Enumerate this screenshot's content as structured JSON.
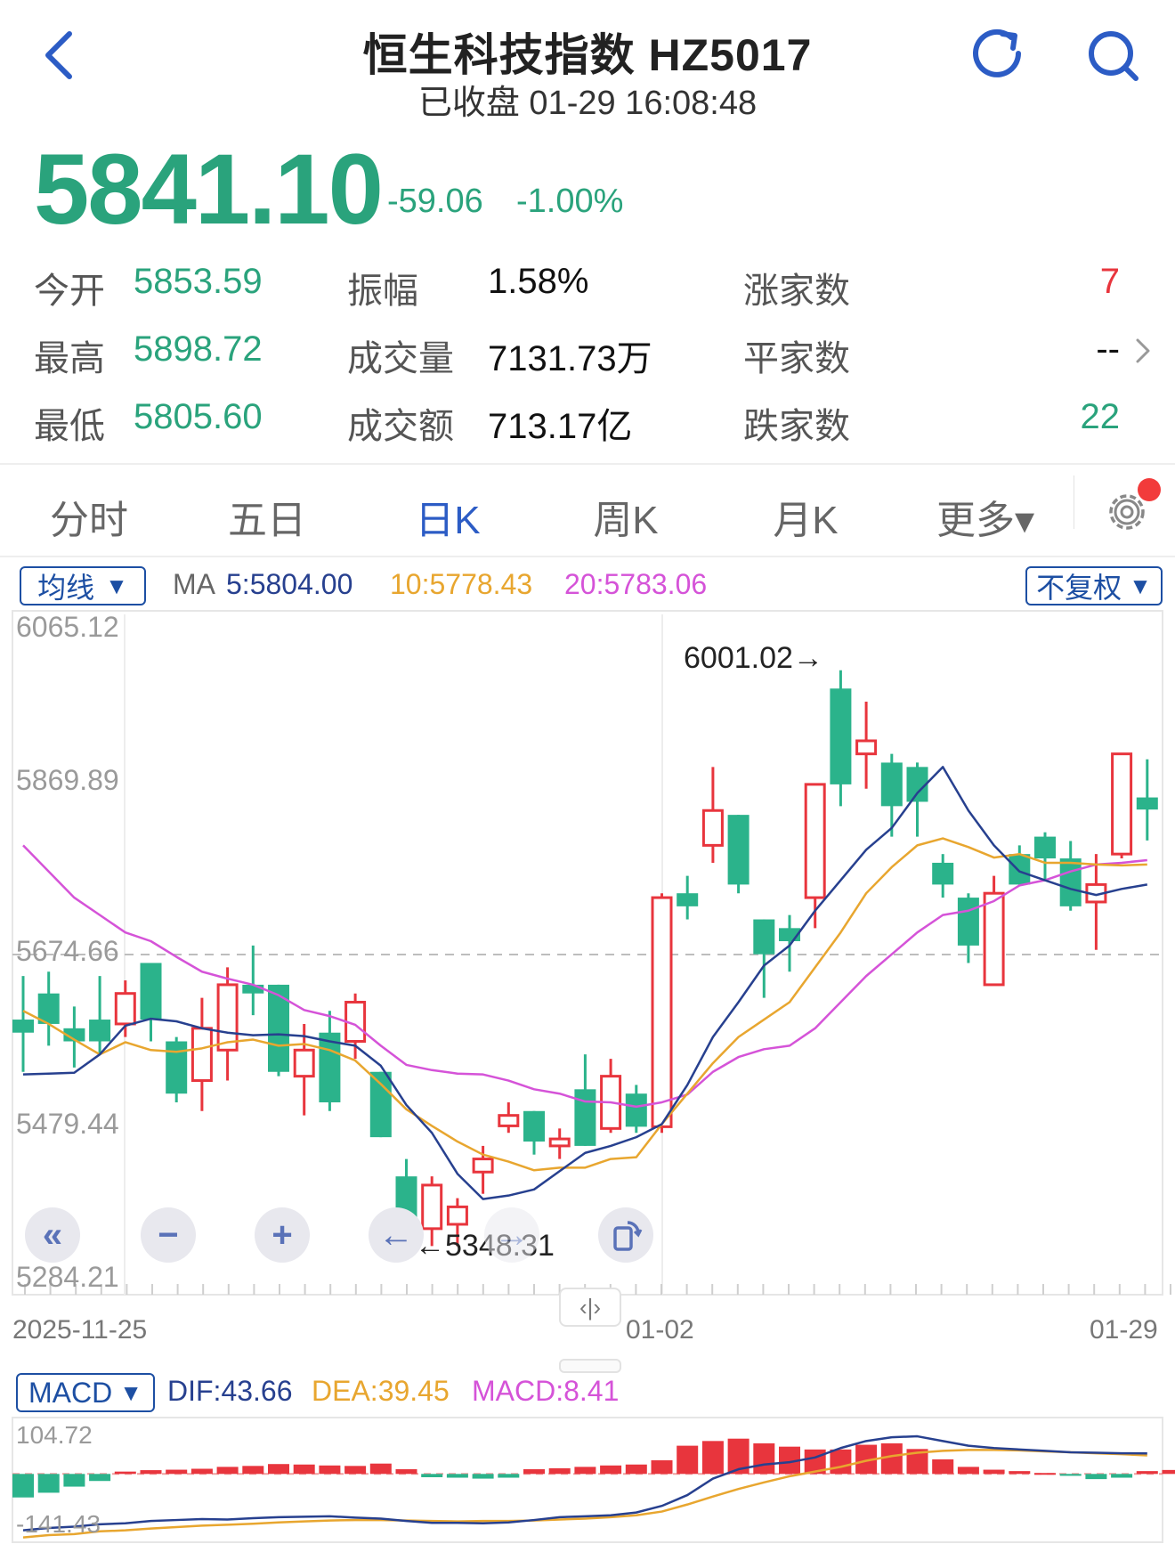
{
  "header": {
    "title": "恒生科技指数 HZ5017",
    "subtitle": "已收盘 01-29 16:08:48"
  },
  "quote": {
    "price": "5841.10",
    "change": "-59.06",
    "change_pct": "-1.00%",
    "stats": [
      {
        "label": "今开",
        "value": "5853.59"
      },
      {
        "label": "最高",
        "value": "5898.72"
      },
      {
        "label": "最低",
        "value": "5805.60"
      },
      {
        "label": "振幅",
        "value": "1.58%"
      },
      {
        "label": "成交量",
        "value": "7131.73万"
      },
      {
        "label": "成交额",
        "value": "713.17亿"
      },
      {
        "label": "涨家数",
        "value": "7"
      },
      {
        "label": "平家数",
        "value": "--"
      },
      {
        "label": "跌家数",
        "value": "22"
      }
    ]
  },
  "tabs": [
    {
      "label": "分时"
    },
    {
      "label": "五日"
    },
    {
      "label": "日K"
    },
    {
      "label": "周K"
    },
    {
      "label": "月K"
    },
    {
      "label": "更多▾"
    }
  ],
  "active_tab": "日K",
  "legend": {
    "ma_selector": "均线",
    "ma_prefix": "MA",
    "ma5": "5:5804.00",
    "ma10": "10:5778.43",
    "ma20": "20:5783.06",
    "adjust_selector": "不复权",
    "macd_selector": "MACD",
    "dif": "DIF:43.66",
    "dea": "DEA:39.45",
    "macd": "MACD:8.41"
  },
  "colors": {
    "up": "#e8353d",
    "down": "#2bb38b",
    "ma5": "#27408f",
    "ma10": "#e8a62f",
    "ma20": "#d553d8",
    "accent": "#2c5cc5"
  },
  "chart": {
    "y_ticks": [
      "6065.12",
      "5869.89",
      "5674.66",
      "5479.44",
      "5284.21"
    ],
    "high_marker": "6001.02→",
    "low_marker": "←5348.31",
    "dates": [
      "2025-11-25",
      "01-02",
      "01-29"
    ],
    "macd_ticks": [
      "104.72",
      "-141.43"
    ]
  },
  "chart_data": {
    "type": "candlestick",
    "ylim": [
      5284.21,
      6065.12
    ],
    "reference_price": 5674.66,
    "candles": [
      {
        "o": 5600,
        "c": 5585,
        "h": 5650,
        "l": 5540
      },
      {
        "o": 5630,
        "c": 5595,
        "h": 5655,
        "l": 5570
      },
      {
        "o": 5590,
        "c": 5575,
        "h": 5615,
        "l": 5545
      },
      {
        "o": 5600,
        "c": 5575,
        "h": 5650,
        "l": 5560
      },
      {
        "o": 5595,
        "c": 5630,
        "h": 5645,
        "l": 5580
      },
      {
        "o": 5665,
        "c": 5600,
        "h": 5665,
        "l": 5575
      },
      {
        "o": 5575,
        "c": 5515,
        "h": 5580,
        "l": 5505
      },
      {
        "o": 5530,
        "c": 5590,
        "h": 5625,
        "l": 5495
      },
      {
        "o": 5565,
        "c": 5640,
        "h": 5660,
        "l": 5530
      },
      {
        "o": 5640,
        "c": 5630,
        "h": 5685,
        "l": 5605
      },
      {
        "o": 5640,
        "c": 5540,
        "h": 5640,
        "l": 5535
      },
      {
        "o": 5535,
        "c": 5565,
        "h": 5595,
        "l": 5490
      },
      {
        "o": 5585,
        "c": 5505,
        "h": 5610,
        "l": 5495
      },
      {
        "o": 5575,
        "c": 5620,
        "h": 5630,
        "l": 5555
      },
      {
        "o": 5540,
        "c": 5465,
        "h": 5540,
        "l": 5465
      },
      {
        "o": 5420,
        "c": 5345,
        "h": 5440,
        "l": 5330
      },
      {
        "o": 5360,
        "c": 5410,
        "h": 5420,
        "l": 5340
      },
      {
        "o": 5365,
        "c": 5385,
        "h": 5395,
        "l": 5340
      },
      {
        "o": 5425,
        "c": 5440,
        "h": 5455,
        "l": 5400
      },
      {
        "o": 5478,
        "c": 5490,
        "h": 5505,
        "l": 5470
      },
      {
        "o": 5495,
        "c": 5460,
        "h": 5495,
        "l": 5445
      },
      {
        "o": 5455,
        "c": 5463,
        "h": 5475,
        "l": 5440
      },
      {
        "o": 5520,
        "c": 5455,
        "h": 5560,
        "l": 5455
      },
      {
        "o": 5475,
        "c": 5535,
        "h": 5555,
        "l": 5470
      },
      {
        "o": 5515,
        "c": 5477,
        "h": 5525,
        "l": 5470
      },
      {
        "o": 5477,
        "c": 5740,
        "h": 5745,
        "l": 5470
      },
      {
        "o": 5745,
        "c": 5730,
        "h": 5765,
        "l": 5715
      },
      {
        "o": 5800,
        "c": 5840,
        "h": 5890,
        "l": 5780
      },
      {
        "o": 5835,
        "c": 5755,
        "h": 5835,
        "l": 5745
      },
      {
        "o": 5715,
        "c": 5675,
        "h": 5715,
        "l": 5625
      },
      {
        "o": 5705,
        "c": 5690,
        "h": 5720,
        "l": 5655
      },
      {
        "o": 5740,
        "c": 5870,
        "h": 5870,
        "l": 5705
      },
      {
        "o": 5980,
        "c": 5870,
        "h": 6001.02,
        "l": 5845
      },
      {
        "o": 5905,
        "c": 5920,
        "h": 5965,
        "l": 5865
      },
      {
        "o": 5895,
        "c": 5845,
        "h": 5905,
        "l": 5810
      },
      {
        "o": 5890,
        "c": 5850,
        "h": 5895,
        "l": 5810
      },
      {
        "o": 5780,
        "c": 5755,
        "h": 5790,
        "l": 5740
      },
      {
        "o": 5740,
        "c": 5685,
        "h": 5745,
        "l": 5665
      },
      {
        "o": 5640,
        "c": 5745,
        "h": 5765,
        "l": 5640
      },
      {
        "o": 5790,
        "c": 5755,
        "h": 5800,
        "l": 5755
      },
      {
        "o": 5810,
        "c": 5785,
        "h": 5815,
        "l": 5760
      },
      {
        "o": 5785,
        "c": 5730,
        "h": 5805,
        "l": 5725
      },
      {
        "o": 5735,
        "c": 5755,
        "h": 5790,
        "l": 5680
      },
      {
        "o": 5790,
        "c": 5905,
        "h": 5905,
        "l": 5785
      },
      {
        "o": 5855,
        "c": 5841.1,
        "h": 5898.72,
        "l": 5805.6
      }
    ],
    "ma5": [
      5537,
      5538,
      5539,
      5560,
      5593,
      5601,
      5598,
      5590,
      5585,
      5582,
      5583,
      5581,
      5575,
      5570,
      5547,
      5502,
      5470,
      5423,
      5394,
      5398,
      5405,
      5426,
      5447,
      5455,
      5465,
      5480,
      5525,
      5580,
      5620,
      5662,
      5685,
      5725,
      5760,
      5795,
      5820,
      5860,
      5890,
      5840,
      5800,
      5770,
      5760,
      5750,
      5743,
      5750,
      5755
    ],
    "ma10": [
      5610,
      5595,
      5577,
      5560,
      5574,
      5565,
      5563,
      5567,
      5574,
      5577,
      5570,
      5572,
      5565,
      5553,
      5526,
      5497,
      5478,
      5460,
      5445,
      5437,
      5427,
      5430,
      5430,
      5440,
      5442,
      5480,
      5515,
      5550,
      5580,
      5600,
      5620,
      5660,
      5700,
      5745,
      5775,
      5800,
      5808,
      5798,
      5786,
      5790,
      5780,
      5780,
      5778,
      5777,
      5778
    ],
    "ma20": [
      5800,
      5770,
      5740,
      5720,
      5700,
      5690,
      5672,
      5655,
      5647,
      5640,
      5628,
      5611,
      5604,
      5594,
      5570,
      5548,
      5542,
      5538,
      5537,
      5530,
      5520,
      5515,
      5506,
      5505,
      5500,
      5505,
      5514,
      5540,
      5557,
      5566,
      5570,
      5590,
      5620,
      5650,
      5675,
      5700,
      5720,
      5725,
      5736,
      5754,
      5760,
      5770,
      5778,
      5780,
      5783
    ],
    "macd_ylim": [
      -141.43,
      104.72
    ],
    "macd_hist": [
      -50,
      -40,
      -27,
      -15,
      5,
      8,
      9,
      11,
      15,
      17,
      21,
      20,
      18,
      17,
      22,
      10,
      -7,
      -8,
      -10,
      -8,
      10,
      12,
      15,
      18,
      20,
      29,
      60,
      70,
      75,
      65,
      58,
      52,
      52,
      62,
      65,
      53,
      31,
      15,
      9,
      6,
      2,
      -4,
      -11,
      -8,
      6,
      8.41
    ],
    "dif": [
      -120,
      -115,
      -112,
      -107,
      -105,
      -100,
      -98,
      -96,
      -97,
      -94,
      -92,
      -91,
      -90,
      -93,
      -95,
      -100,
      -104,
      -104,
      -105,
      -103,
      -98,
      -92,
      -90,
      -88,
      -82,
      -68,
      -45,
      -10,
      10,
      20,
      25,
      35,
      55,
      70,
      78,
      80,
      70,
      60,
      55,
      52,
      49,
      46,
      45,
      44,
      43.66
    ],
    "dea": [
      -135,
      -130,
      -128,
      -122,
      -120,
      -116,
      -113,
      -110,
      -108,
      -106,
      -103,
      -101,
      -99,
      -98,
      -98,
      -99,
      -100,
      -101,
      -100,
      -100,
      -99,
      -97,
      -95,
      -92,
      -88,
      -80,
      -65,
      -48,
      -32,
      -18,
      -5,
      5,
      15,
      28,
      38,
      45,
      49,
      51,
      51,
      50,
      48,
      46,
      44,
      42,
      39.45
    ]
  }
}
